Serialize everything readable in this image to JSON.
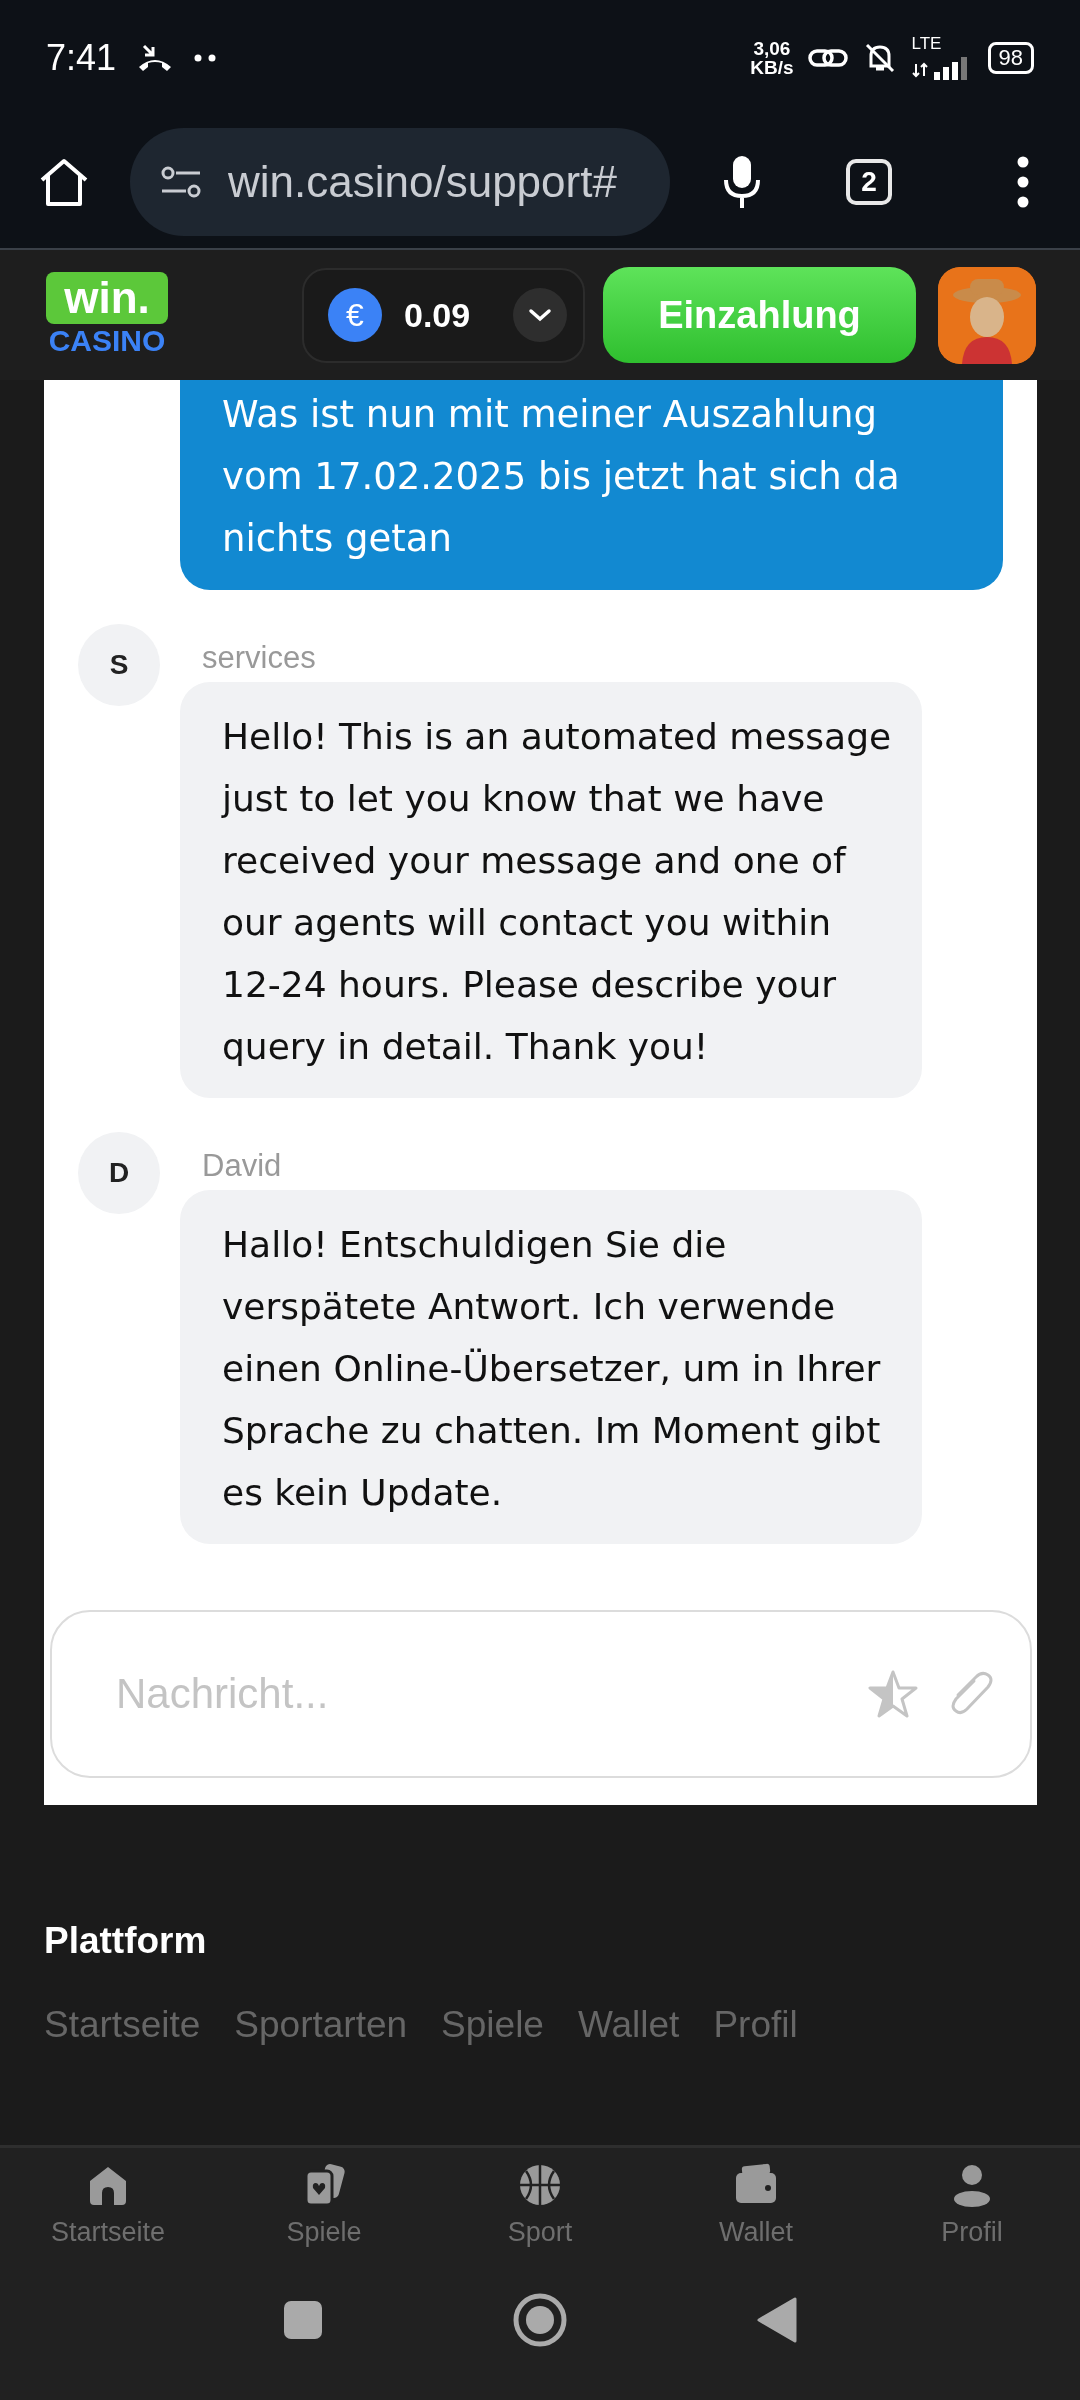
{
  "status_bar": {
    "time": "7:41",
    "speed_value": "3,06",
    "speed_unit": "KB/s",
    "network": "LTE",
    "battery": "98"
  },
  "browser": {
    "url": "win.casino/support#",
    "tab_count": "2"
  },
  "header": {
    "logo_top": "win.",
    "logo_bottom": "CASINO",
    "currency": "€",
    "balance": "0.09",
    "deposit": "Einzahlung"
  },
  "messages": [
    {
      "kind": "outgoing",
      "text": "Was ist nun mit meiner Auszahlung vom 17.02.2025 bis jetzt hat sich da nichts getan"
    },
    {
      "kind": "incoming",
      "author": "services",
      "initial": "S",
      "text": "Hello! This is an automated message just to let you know that we have received your message and one of our agents will contact you within 12-24 hours. Please describe your query in detail. Thank you!"
    },
    {
      "kind": "incoming",
      "author": "David",
      "initial": "D",
      "text": "Hallo! Entschuldigen Sie die verspätete Antwort. Ich verwende einen Online-Übersetzer, um in Ihrer Sprache zu chatten. Im Moment gibt es kein Update."
    }
  ],
  "composer": {
    "placeholder": "Nachricht..."
  },
  "footer": {
    "title": "Plattform",
    "links": [
      "Startseite",
      "Sportarten",
      "Spiele",
      "Wallet",
      "Profil"
    ]
  },
  "nav": [
    {
      "kind": "home",
      "label": "Startseite"
    },
    {
      "kind": "games",
      "label": "Spiele"
    },
    {
      "kind": "sport",
      "label": "Sport"
    },
    {
      "kind": "wallet",
      "label": "Wallet"
    },
    {
      "kind": "profile",
      "label": "Profil"
    }
  ]
}
